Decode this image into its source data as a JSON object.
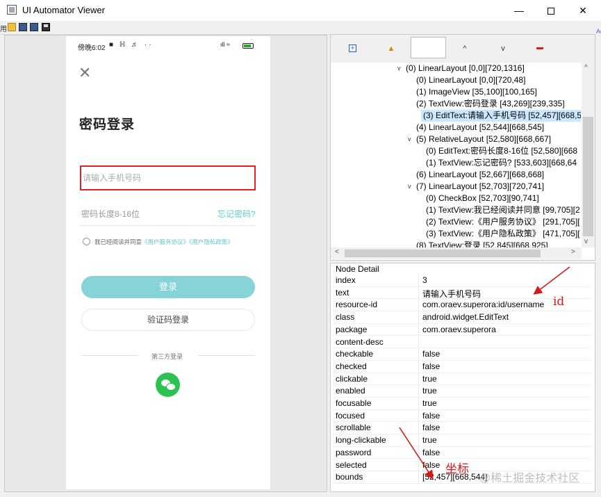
{
  "window": {
    "title": "UI Automator Viewer",
    "minimize_glyph": "—",
    "close_glyph": "✕"
  },
  "toolbar": {
    "icons": [
      "open-folder-icon",
      "device-screenshot-icon",
      "device-screenshot-compressed-icon",
      "save-icon"
    ]
  },
  "edge_labels": {
    "left": "用",
    "right": "Ac"
  },
  "phone": {
    "status_time": "傍晚6:02",
    "status_left_icons": "■ ℍ ♬ ··",
    "status_right_icons": "ıll ≈",
    "close_glyph": "✕",
    "title": "密码登录",
    "phone_placeholder": "请输入手机号码",
    "password_placeholder": "密码长度8-16位",
    "forgot_password": "忘记密码?",
    "agree_prefix": "我已经阅读并同意",
    "agree_link_1": "《用户服务协议》",
    "agree_link_2": "《用户隐私政策》",
    "login_button": "登录",
    "code_login_button": "验证码登录",
    "third_party_label": "第三方登录"
  },
  "tree_toolbar": {
    "expand_glyph": "+",
    "warning_glyph": "▲",
    "up_glyph": "^",
    "down_glyph": "v"
  },
  "tree": {
    "rows": [
      {
        "text": "(0) LinearLayout [0,0][720,1316]",
        "toggle": "v"
      },
      {
        "text": "(0) LinearLayout [0,0][720,48]",
        "toggle": ""
      },
      {
        "text": "(1) ImageView [35,100][100,165]",
        "toggle": ""
      },
      {
        "text": "(2) TextView:密码登录 [43,269][239,335]",
        "toggle": ""
      },
      {
        "text": "(3) EditText:请输入手机号码 [52,457][668,54",
        "toggle": "",
        "selected": true
      },
      {
        "text": "(4) LinearLayout [52,544][668,545]",
        "toggle": ""
      },
      {
        "text": "(5) RelativeLayout [52,580][668,667]",
        "toggle": "v"
      },
      {
        "text": "(0) EditText:密码长度8-16位 [52,580][668",
        "toggle": ""
      },
      {
        "text": "(1) TextView:忘记密码? [533,603][668,64",
        "toggle": ""
      },
      {
        "text": "(6) LinearLayout [52,667][668,668]",
        "toggle": ""
      },
      {
        "text": "(7) LinearLayout [52,703][720,741]",
        "toggle": "v"
      },
      {
        "text": "(0) CheckBox [52,703][90,741]",
        "toggle": ""
      },
      {
        "text": "(1) TextView:我已经阅读并同意 [99,705][2",
        "toggle": ""
      },
      {
        "text": "(2) TextView:《用户服务协议》 [291,705][",
        "toggle": ""
      },
      {
        "text": "(3) TextView:《用户隐私政策》 [471,705][",
        "toggle": ""
      },
      {
        "text": "(8) TextView:登录 [52,845][668,925]",
        "toggle": ""
      }
    ],
    "scroll_up": "^",
    "scroll_down": "v",
    "scroll_left": "<",
    "scroll_right": ">"
  },
  "node_detail": {
    "title": "Node Detail",
    "rows": [
      {
        "key": "index",
        "value": "3"
      },
      {
        "key": "text",
        "value": "请输入手机号码"
      },
      {
        "key": "resource-id",
        "value": "com.oraev.superora:id/username"
      },
      {
        "key": "class",
        "value": "android.widget.EditText"
      },
      {
        "key": "package",
        "value": "com.oraev.superora"
      },
      {
        "key": "content-desc",
        "value": ""
      },
      {
        "key": "checkable",
        "value": "false"
      },
      {
        "key": "checked",
        "value": "false"
      },
      {
        "key": "clickable",
        "value": "true"
      },
      {
        "key": "enabled",
        "value": "true"
      },
      {
        "key": "focusable",
        "value": "true"
      },
      {
        "key": "focused",
        "value": "false"
      },
      {
        "key": "scrollable",
        "value": "false"
      },
      {
        "key": "long-clickable",
        "value": "true"
      },
      {
        "key": "password",
        "value": "false"
      },
      {
        "key": "selected",
        "value": "false"
      },
      {
        "key": "bounds",
        "value": "[52,457][668,544]"
      }
    ]
  },
  "annotations": {
    "id_label": "id",
    "coord_label": "坐标",
    "color": "#d81818"
  },
  "watermark": "@稀土掘金技术社区"
}
